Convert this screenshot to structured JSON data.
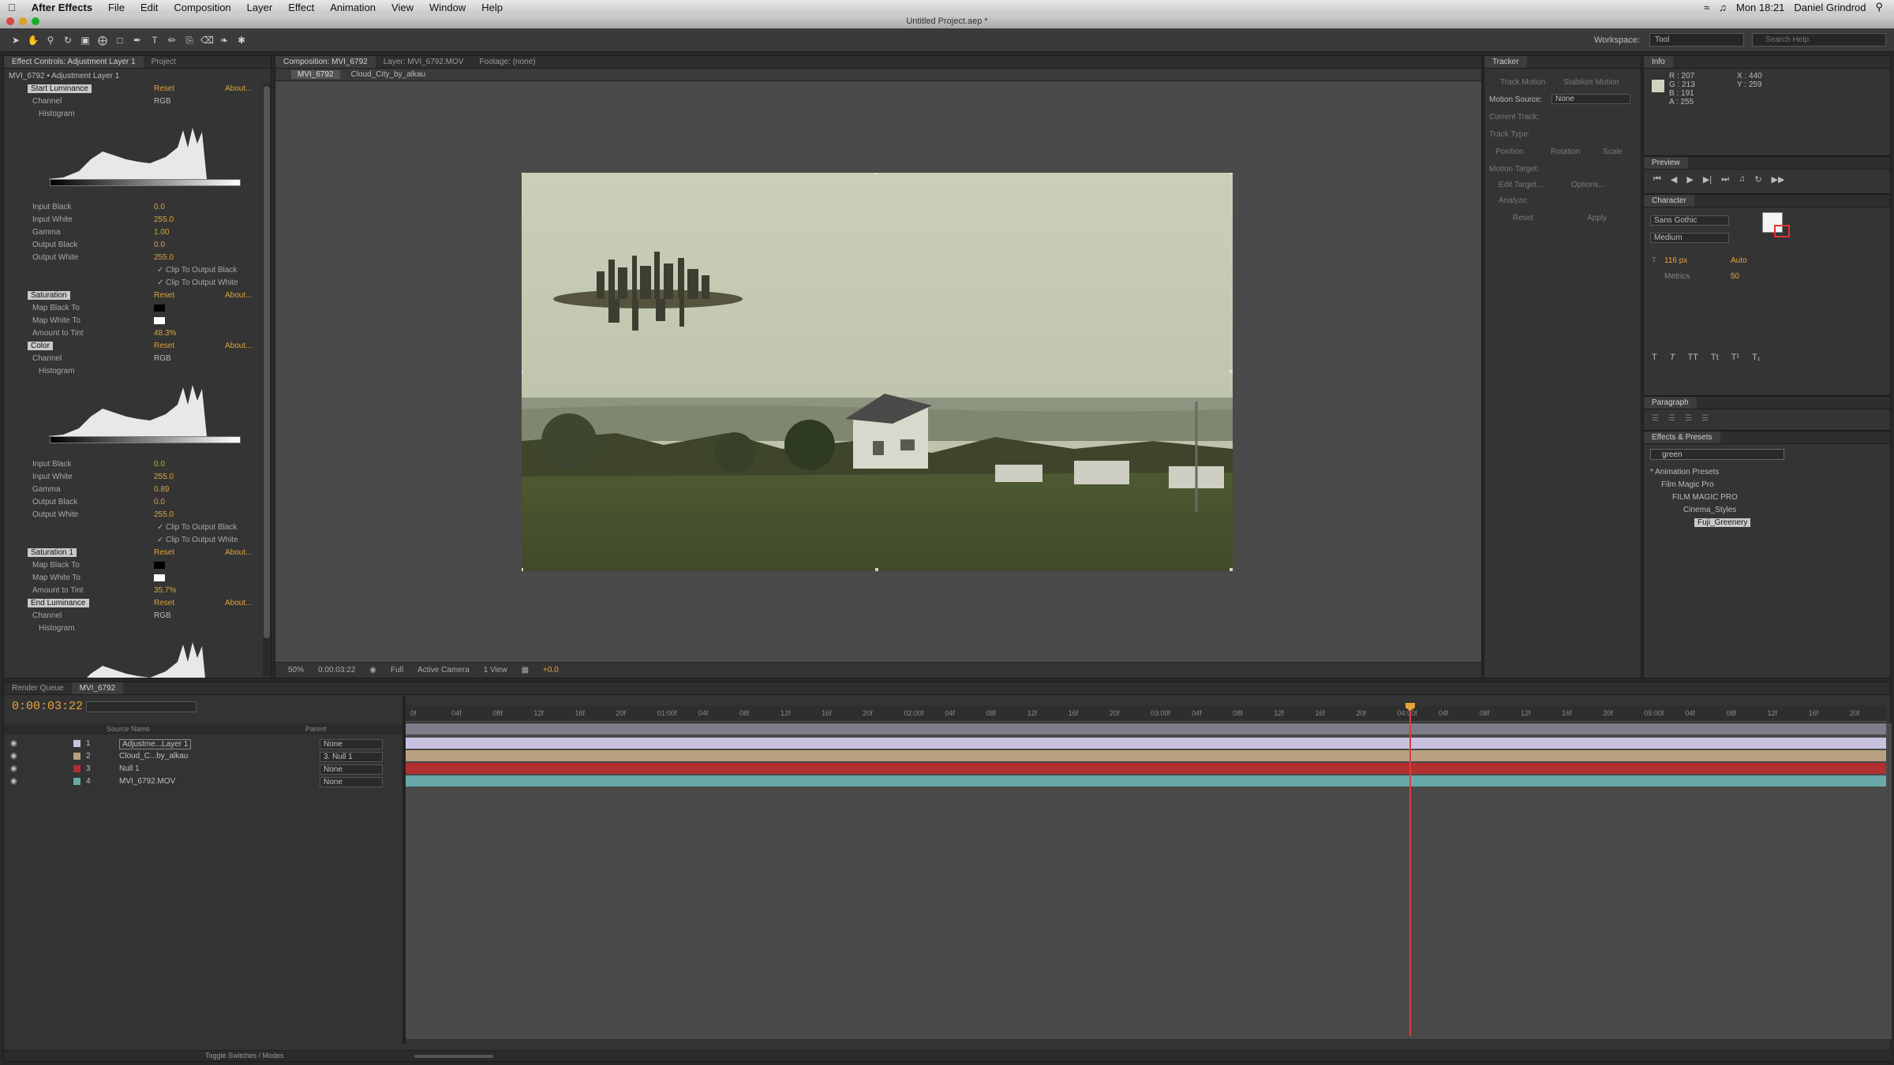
{
  "menubar": {
    "app": "After Effects",
    "items": [
      "File",
      "Edit",
      "Composition",
      "Layer",
      "Effect",
      "Animation",
      "View",
      "Window",
      "Help"
    ],
    "clock": "Mon 18:21",
    "user": "Daniel Grindrod"
  },
  "window": {
    "title": "Untitled Project.aep *"
  },
  "toolbar": {
    "workspace_label": "Workspace:",
    "workspace_value": "Tool",
    "search_placeholder": "Search Help"
  },
  "effect_controls": {
    "tabs": [
      "Effect Controls: Adjustment Layer 1",
      "Project"
    ],
    "layer_path": "MVI_6792 • Adjustment Layer 1",
    "reset_label": "Reset",
    "about_label": "About...",
    "rows": [
      {
        "label": "Start Luminance",
        "kind": "effect",
        "value": ""
      },
      {
        "label": "Channel",
        "kind": "prop",
        "value": "RGB"
      },
      {
        "label": "Histogram",
        "kind": "prop",
        "value": ""
      },
      {
        "label": "Input Black",
        "kind": "prop",
        "value": "0.0"
      },
      {
        "label": "Input White",
        "kind": "prop",
        "value": "255.0"
      },
      {
        "label": "Gamma",
        "kind": "prop",
        "value": "1.00"
      },
      {
        "label": "Output Black",
        "kind": "prop",
        "value": "0.0"
      },
      {
        "label": "Output White",
        "kind": "prop",
        "value": "255.0"
      },
      {
        "label": "Clip To Output Black",
        "kind": "check",
        "value": ""
      },
      {
        "label": "Clip To Output White",
        "kind": "check",
        "value": ""
      },
      {
        "label": "Saturation",
        "kind": "effect",
        "value": ""
      },
      {
        "label": "Map Black To",
        "kind": "color",
        "value": ""
      },
      {
        "label": "Map White To",
        "kind": "color",
        "value": ""
      },
      {
        "label": "Amount to Tint",
        "kind": "prop",
        "value": "48.3%"
      },
      {
        "label": "Color",
        "kind": "effect",
        "value": ""
      },
      {
        "label": "Channel",
        "kind": "prop",
        "value": "RGB"
      },
      {
        "label": "Histogram",
        "kind": "prop",
        "value": ""
      },
      {
        "label": "Input Black",
        "kind": "prop",
        "value": "0.0"
      },
      {
        "label": "Input White",
        "kind": "prop",
        "value": "255.0"
      },
      {
        "label": "Gamma",
        "kind": "prop",
        "value": "0.89"
      },
      {
        "label": "Output Black",
        "kind": "prop",
        "value": "0.0"
      },
      {
        "label": "Output White",
        "kind": "prop",
        "value": "255.0"
      },
      {
        "label": "Clip To Output Black",
        "kind": "check",
        "value": ""
      },
      {
        "label": "Clip To Output White",
        "kind": "check",
        "value": ""
      },
      {
        "label": "Saturation 1",
        "kind": "effect",
        "value": ""
      },
      {
        "label": "Map Black To",
        "kind": "color",
        "value": ""
      },
      {
        "label": "Map White To",
        "kind": "color",
        "value": ""
      },
      {
        "label": "Amount to Tint",
        "kind": "prop",
        "value": "35.7%"
      },
      {
        "label": "End Luminance",
        "kind": "effect",
        "value": ""
      },
      {
        "label": "Channel",
        "kind": "prop",
        "value": "RGB"
      },
      {
        "label": "Histogram",
        "kind": "prop",
        "value": ""
      }
    ]
  },
  "composition": {
    "tabs": [
      "Composition: MVI_6792",
      "Layer: MVI_6792.MOV",
      "Footage: (none)"
    ],
    "crumbs": [
      "MVI_6792",
      "Cloud_City_by_alkau"
    ],
    "zoom": "50%",
    "timecode": "0:00:03:22",
    "resolution": "Full",
    "camera": "Active Camera",
    "views": "1 View",
    "exposure": "+0.0"
  },
  "tracker": {
    "title": "Tracker",
    "buttons": [
      "Track Motion",
      "Stabilize Motion"
    ],
    "motion_source_label": "Motion Source:",
    "motion_source_value": "None",
    "current_track": "Current Track:",
    "track_type": "Track Type:",
    "options": [
      "Position",
      "Rotation",
      "Scale"
    ],
    "motion_target": "Motion Target:",
    "edit_target": "Edit Target...",
    "options_btn": "Options...",
    "analyze": "Analyze:",
    "reset": "Reset",
    "apply": "Apply"
  },
  "info": {
    "title": "Info",
    "r": "R : 207",
    "g": "G : 213",
    "b": "B : 191",
    "a": "A : 255",
    "x": "X : 440",
    "y": "Y : 259"
  },
  "preview": {
    "title": "Preview"
  },
  "character": {
    "title": "Character",
    "font": "Sans Gothic",
    "style": "Medium",
    "size": "116 px",
    "leading": "Auto",
    "kerning": "Metrics",
    "tracking": "50"
  },
  "paragraph": {
    "title": "Paragraph"
  },
  "effects_presets": {
    "title": "Effects & Presets",
    "search": "green",
    "tree": [
      "* Animation Presets",
      "Film Magic Pro",
      "FILM MAGIC PRO",
      "Cinema_Styles",
      "Fuji_Greenery"
    ]
  },
  "timeline": {
    "tabs": [
      "Render Queue",
      "MVI_6792"
    ],
    "timecode": "0:00:03:22",
    "col_source": "Source Name",
    "col_parent": "Parent",
    "layers": [
      {
        "num": "1",
        "name": "Adjustme...Layer 1",
        "parent": "None",
        "color": "#c8c2e0"
      },
      {
        "num": "2",
        "name": "Cloud_C...by_alkau",
        "parent": "3. Null 1",
        "color": "#b8a080"
      },
      {
        "num": "3",
        "name": "Null 1",
        "parent": "None",
        "color": "#b22f2f"
      },
      {
        "num": "4",
        "name": "MVI_6792.MOV",
        "parent": "None",
        "color": "#6aa9a9"
      }
    ],
    "ruler": [
      "0f",
      "04f",
      "08f",
      "12f",
      "16f",
      "20f",
      "01:00f",
      "04f",
      "08f",
      "12f",
      "16f",
      "20f",
      "02:00f",
      "04f",
      "08f",
      "12f",
      "16f",
      "20f",
      "03:00f",
      "04f",
      "08f",
      "12f",
      "16f",
      "20f",
      "04:00f",
      "04f",
      "08f",
      "12f",
      "16f",
      "20f",
      "05:00f",
      "04f",
      "08f",
      "12f",
      "16f",
      "20f"
    ],
    "playhead": 0.678,
    "toggle_label": "Toggle Switches / Modes"
  },
  "colors": {
    "accent": "#e8a33a",
    "playhead": "#d84040"
  }
}
